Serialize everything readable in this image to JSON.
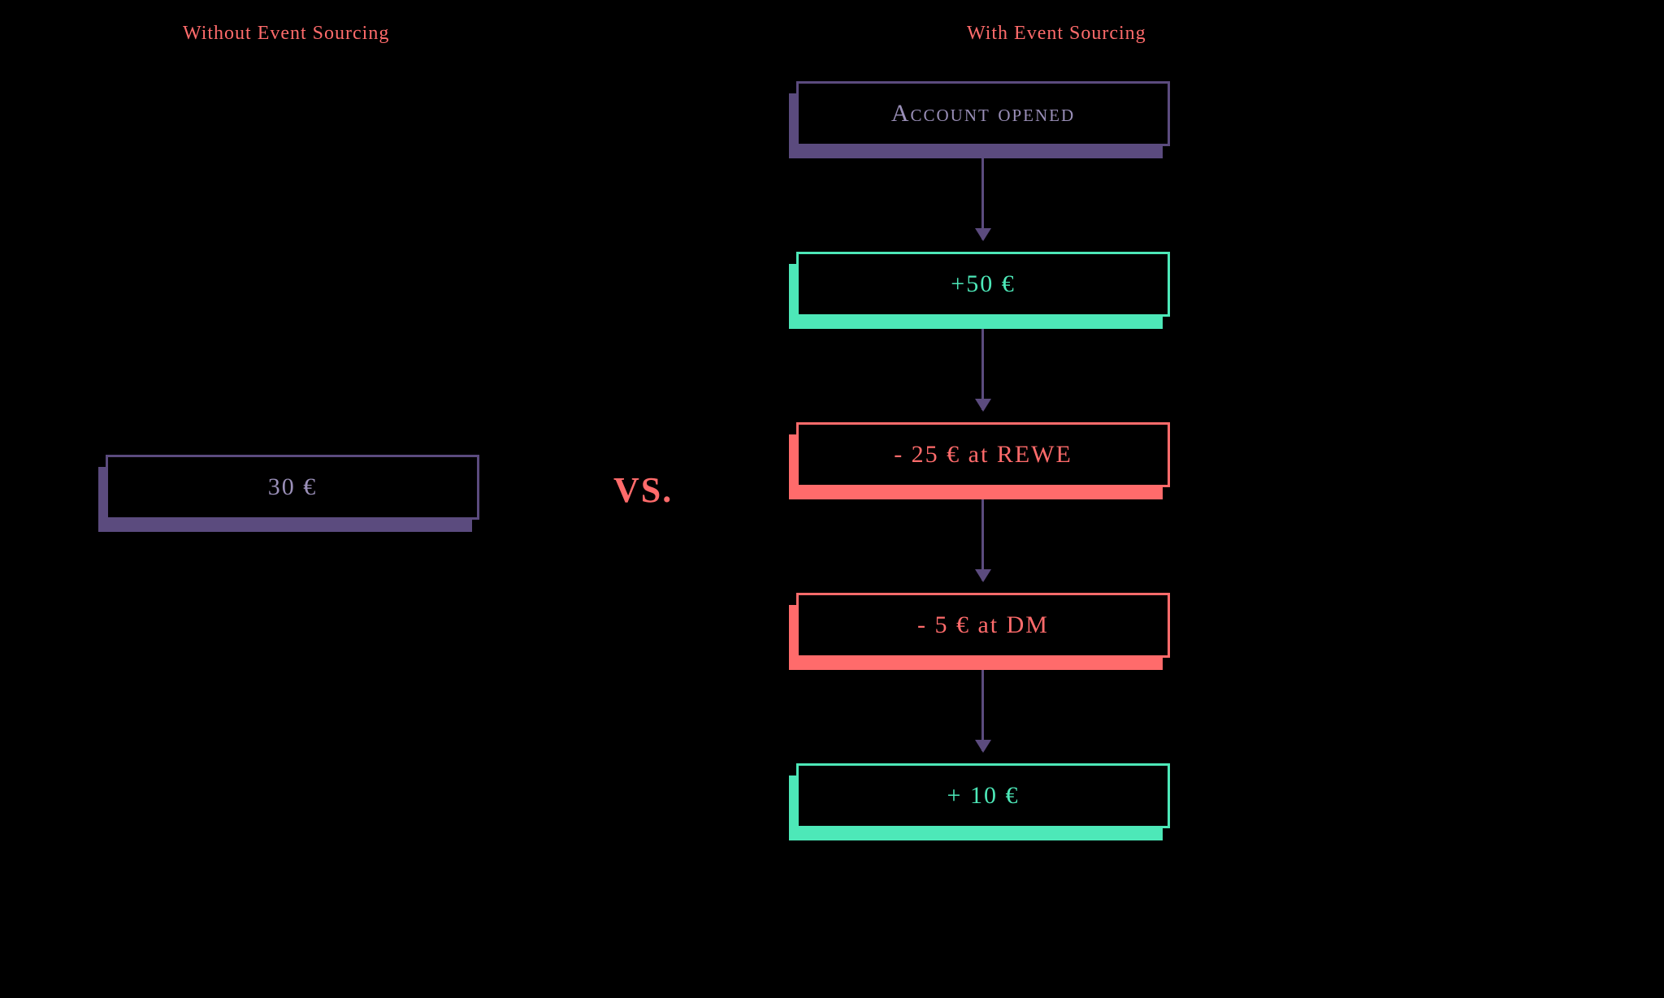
{
  "left": {
    "title": "Without Event Sourcing",
    "balance": "30 €"
  },
  "center": {
    "vs": "VS."
  },
  "right": {
    "title": "With Event Sourcing",
    "events": {
      "opened": "Account opened",
      "deposit1": "+50 €",
      "spend1": "- 25 € at REWE",
      "spend2": "- 5 € at DM",
      "deposit2": "+ 10 €"
    }
  },
  "colors": {
    "purple": "#5b4b7e",
    "green": "#4de8b8",
    "red": "#ff6b6b",
    "bg": "#000000"
  }
}
